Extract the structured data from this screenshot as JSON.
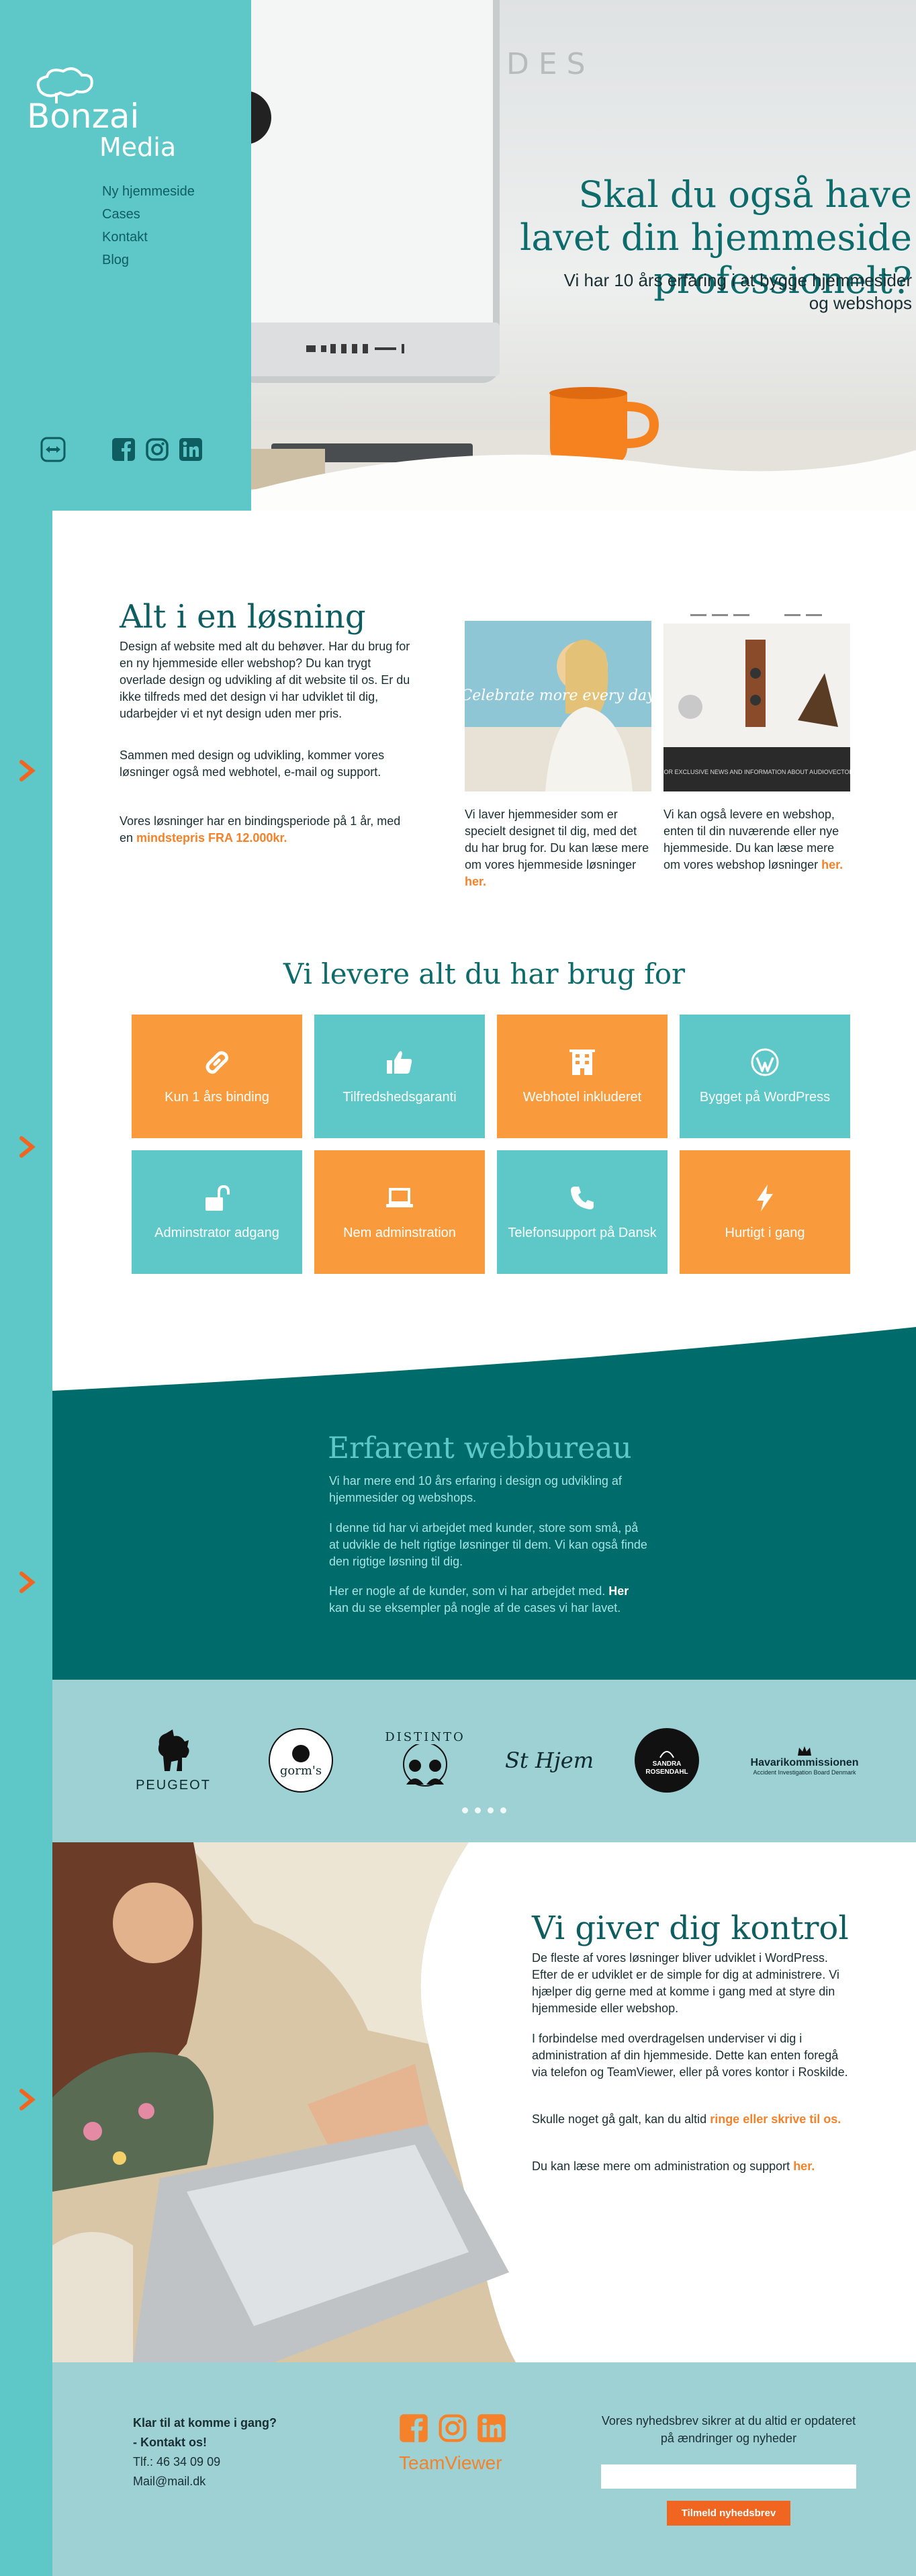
{
  "brand": {
    "line1": "Bonzai",
    "line2": "Media"
  },
  "nav": [
    "Ny hjemmeside",
    "Cases",
    "Kontakt",
    "Blog"
  ],
  "hero": {
    "title": "Skal du også have lavet din hjemmeside professionelt?",
    "subtitle": "Vi har 10 års erfaring i at bygge hjemmesider og webshops"
  },
  "section1": {
    "title": "Alt i en løsning",
    "p1": "Design af website med alt du behøver. Har du brug for en ny hjemmeside eller webshop? Du kan trygt overlade design og udvikling af dit website til os. Er du ikke tilfreds med det design vi har udviklet til dig, udarbejder vi et nyt design uden mer pris.",
    "p2": "Sammen med design og udvikling, kommer vores løsninger også med webhotel, e-mail og support.",
    "p3_pre": "Vores løsninger har en bindingsperiode på 1 år, med en ",
    "p3_highlight": "mindstepris FRA 12.000kr.",
    "image_a_text": "Celebrate more every day",
    "image_b_text": "FOR EXCLUSIVE NEWS AND INFORMATION ABOUT AUDIOVECTOR",
    "caption_a": "Vi laver hjemmesider som er specielt designet til dig, med det du har brug for. Du kan læse mere om vores hjemmeside løsninger ",
    "caption_b": "Vi kan også levere en webshop, enten til din nuværende eller nye hjemmeside. Du kan læse mere om vores webshop løsninger ",
    "link": "her."
  },
  "features": {
    "title": "Vi levere alt du har brug for",
    "items": [
      {
        "label": "Kun 1 års binding",
        "icon": "link-icon",
        "color": "#f99b3c"
      },
      {
        "label": "Tilfredshedsgaranti",
        "icon": "thumbs-up-icon",
        "color": "#5ec8c9"
      },
      {
        "label": "Webhotel inkluderet",
        "icon": "server-icon",
        "color": "#f99b3c"
      },
      {
        "label": "Bygget på WordPress",
        "icon": "wordpress-icon",
        "color": "#5ec8c9"
      },
      {
        "label": "Adminstrator adgang",
        "icon": "unlock-icon",
        "color": "#5ec8c9"
      },
      {
        "label": "Nem adminstration",
        "icon": "laptop-icon",
        "color": "#f99b3c"
      },
      {
        "label": "Telefonsupport på Dansk",
        "icon": "phone-icon",
        "color": "#5ec8c9"
      },
      {
        "label": "Hurtigt i gang",
        "icon": "bolt-icon",
        "color": "#f99b3c"
      }
    ]
  },
  "experience": {
    "title": "Erfarent webbureau",
    "p1": "Vi har mere end 10 års erfaring i design og udvikling af hjemmesider og webshops.",
    "p2": "I denne tid har vi arbejdet med kunder, store som små, på at udvikle de helt rigtige løsninger til dem. Vi kan også finde den rigtige løsning til dig.",
    "p3_pre": "Her er nogle af de kunder, som vi har arbejdet med. ",
    "p3_bold": "Her",
    "p3_post": " kan du se eksempler på nogle af de cases vi har lavet."
  },
  "clients": {
    "peugeot": "PEUGEOT",
    "gorms": "gorm's",
    "distinto": "DISTINTO",
    "stherm": "St Hjem",
    "sandra": "SANDRA ROSENDAHL",
    "havari": "Havarikommissionen",
    "havari_sub": "Accident Investigation Board Denmark"
  },
  "control": {
    "title": "Vi giver dig kontrol",
    "p1": "De fleste af vores løsninger bliver udviklet i WordPress. Efter de er udviklet er de simple for dig at administrere. Vi hjælper dig gerne med at komme i gang med at styre din hjemmeside eller webshop.",
    "p2": "I forbindelse med overdragelsen underviser vi dig i administration af din hjemmeside. Dette kan enten foregå via telefon og TeamViewer, eller på vores kontor i Roskilde.",
    "p3_pre": "Skulle noget gå galt, kan du altid ",
    "p3_link": "ringe eller skrive til os.",
    "p4_pre": "Du kan læse mere om administration og support ",
    "p4_link": "her."
  },
  "footer": {
    "heading": "Klar til at komme i gang?",
    "contact_link": "- Kontakt os!",
    "phone": "Tlf.: 46 34 09 09",
    "email": "Mail@mail.dk",
    "teamviewer": "TeamViewer",
    "newsletter_text": "Vores nyhedsbrev sikrer at du altid er opdateret på ændringer og nyheder",
    "newsletter_button": "Tilmeld nyhedsbrev"
  },
  "colors": {
    "teal": "#5ec8c9",
    "dark_teal": "#006b6b",
    "orange": "#f99b3c",
    "accent": "#f5822a"
  }
}
